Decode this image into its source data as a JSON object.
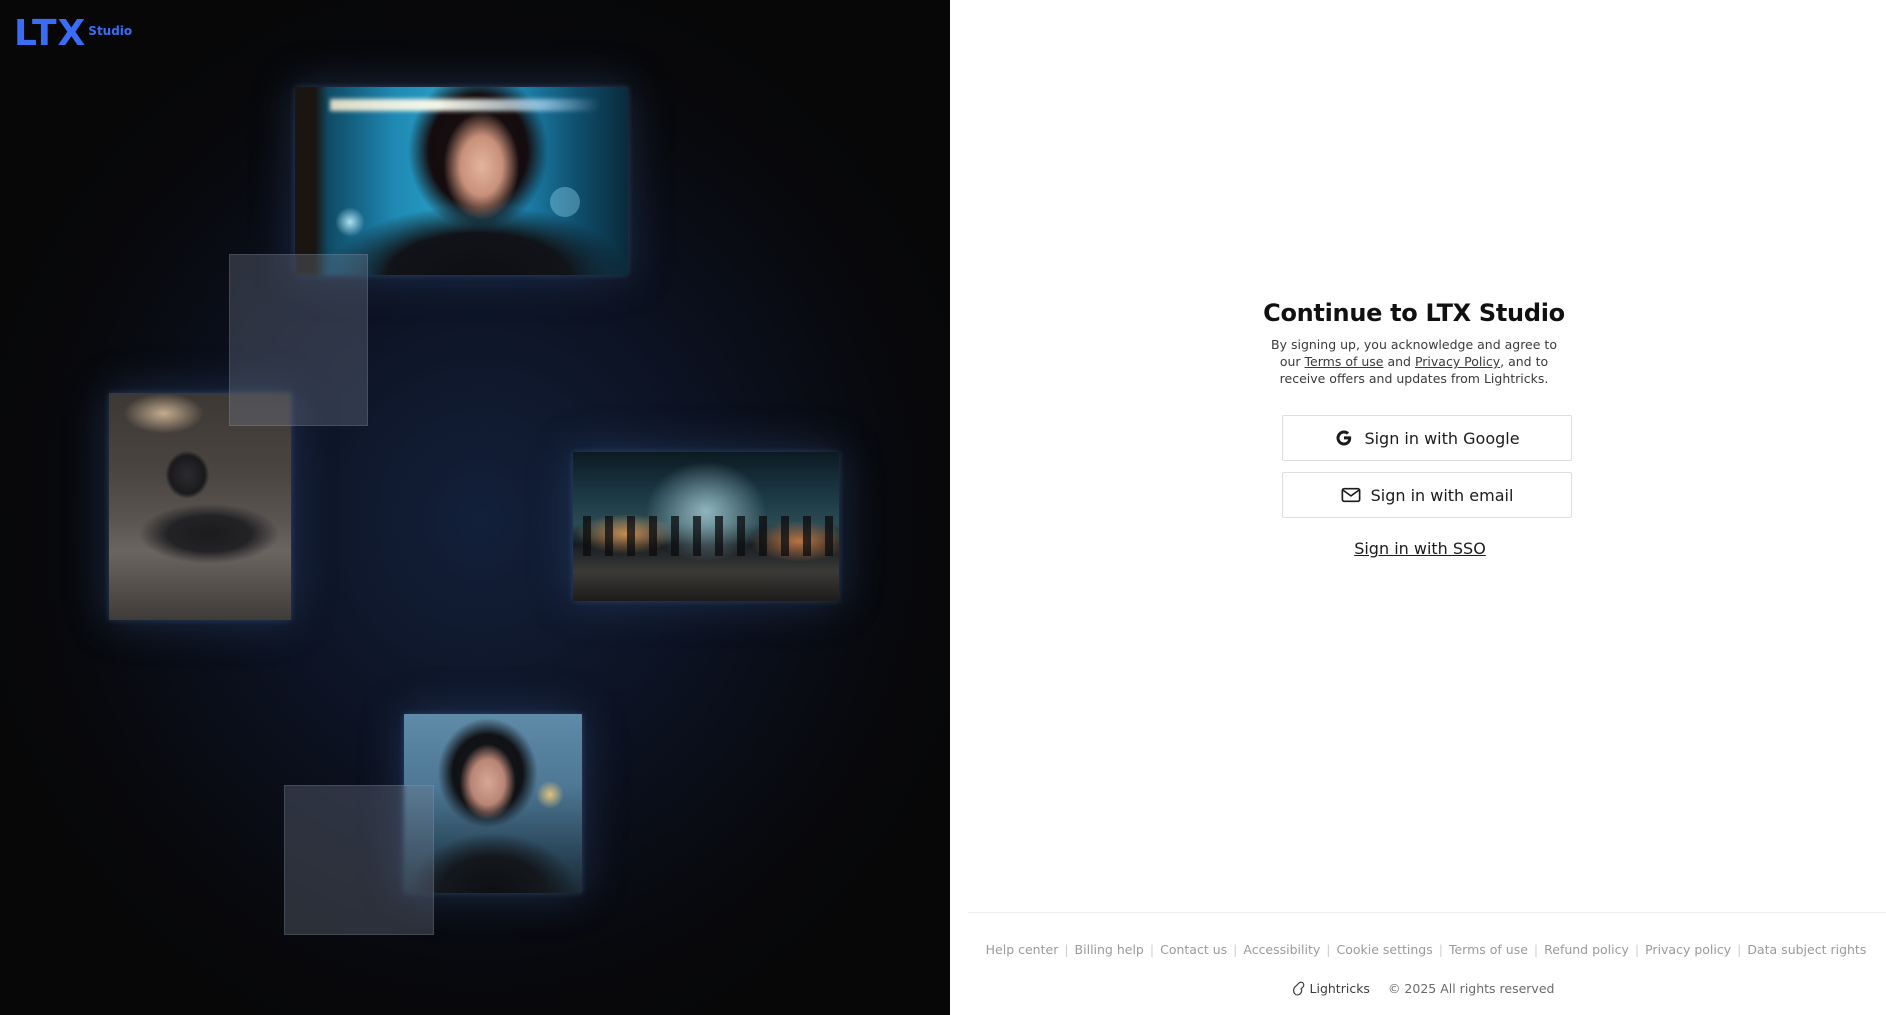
{
  "brand": {
    "logo_text": "LTX",
    "logo_sub": "Studio",
    "accent_color": "#3b6cf6"
  },
  "gallery": {
    "images": [
      {
        "name": "woman-leather-coat-photo"
      },
      {
        "name": "robot-on-floor-photo"
      },
      {
        "name": "rainy-market-street-photo"
      },
      {
        "name": "woman-police-jacket-photo"
      }
    ]
  },
  "auth": {
    "title": "Continue to LTX Studio",
    "legal_prefix": "By signing up, you acknowledge and agree to our ",
    "terms_link": "Terms of use",
    "legal_and": " and ",
    "privacy_link": "Privacy Policy",
    "legal_suffix": ", and to receive offers and updates from Lightricks.",
    "google_button": "Sign in with Google",
    "google_icon": "google-g-icon",
    "email_button": "Sign in with email",
    "email_icon": "envelope-icon",
    "sso_link": "Sign in with SSO"
  },
  "footer": {
    "links": [
      "Help center",
      "Billing help",
      "Contact us",
      "Accessibility",
      "Cookie settings",
      "Terms of use",
      "Refund policy",
      "Privacy policy",
      "Data subject rights"
    ],
    "company": "Lightricks",
    "company_icon": "lightricks-logo-icon",
    "copyright": "© 2025 All rights reserved"
  }
}
